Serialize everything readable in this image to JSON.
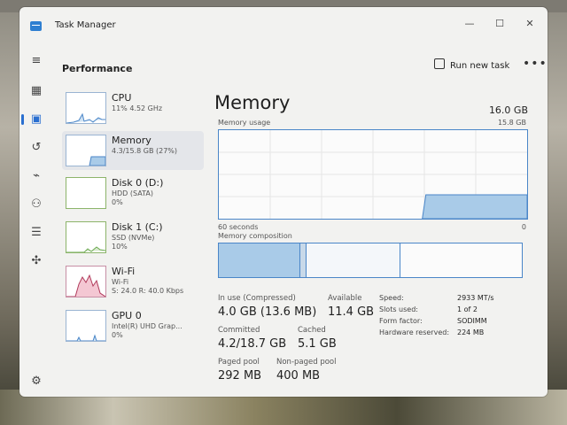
{
  "app": {
    "title": "Task Manager"
  },
  "window_controls": {
    "minimize": "—",
    "maximize": "☐",
    "close": "✕"
  },
  "header": {
    "section": "Performance",
    "run_task": "Run new task",
    "more": "•••"
  },
  "perf_items": [
    {
      "name": "CPU",
      "sub1": "11%  4.52 GHz",
      "sub2": ""
    },
    {
      "name": "Memory",
      "sub1": "4.3/15.8 GB (27%)",
      "sub2": ""
    },
    {
      "name": "Disk 0 (D:)",
      "sub1": "HDD (SATA)",
      "sub2": "0%"
    },
    {
      "name": "Disk 1 (C:)",
      "sub1": "SSD (NVMe)",
      "sub2": "10%"
    },
    {
      "name": "Wi-Fi",
      "sub1": "Wi-Fi",
      "sub2": "S: 24.0  R: 40.0 Kbps"
    },
    {
      "name": "GPU 0",
      "sub1": "Intel(R) UHD Grap...",
      "sub2": "0%"
    }
  ],
  "memory": {
    "title": "Memory",
    "total": "16.0 GB",
    "usage_label": "Memory usage",
    "usage_max": "15.8 GB",
    "time_left": "60 seconds",
    "time_right": "0",
    "composition_label": "Memory composition",
    "usage_level": 0.27,
    "composition": {
      "in_use": 0.27,
      "modified": 0.02,
      "standby": 0.31,
      "free": 0.4
    }
  },
  "stats": {
    "in_use_label": "In use (Compressed)",
    "in_use_value": "4.0 GB (13.6 MB)",
    "available_label": "Available",
    "available_value": "11.4 GB",
    "committed_label": "Committed",
    "committed_value": "4.2/18.7 GB",
    "cached_label": "Cached",
    "cached_value": "5.1 GB",
    "paged_label": "Paged pool",
    "paged_value": "292 MB",
    "nonpaged_label": "Non-paged pool",
    "nonpaged_value": "400 MB"
  },
  "specs": [
    {
      "label": "Speed:",
      "value": "2933 MT/s"
    },
    {
      "label": "Slots used:",
      "value": "1 of 2"
    },
    {
      "label": "Form factor:",
      "value": "SODIMM"
    },
    {
      "label": "Hardware reserved:",
      "value": "224 MB"
    }
  ],
  "colors": {
    "accent": "#2a6fd0",
    "memory_fill": "#a9cbe8",
    "memory_line": "#4a86c8"
  },
  "icons": {
    "nav": [
      "hamburger-icon",
      "processes-icon",
      "performance-icon",
      "app-history-icon",
      "startup-apps-icon",
      "users-icon",
      "details-icon",
      "services-icon",
      "settings-icon"
    ]
  }
}
